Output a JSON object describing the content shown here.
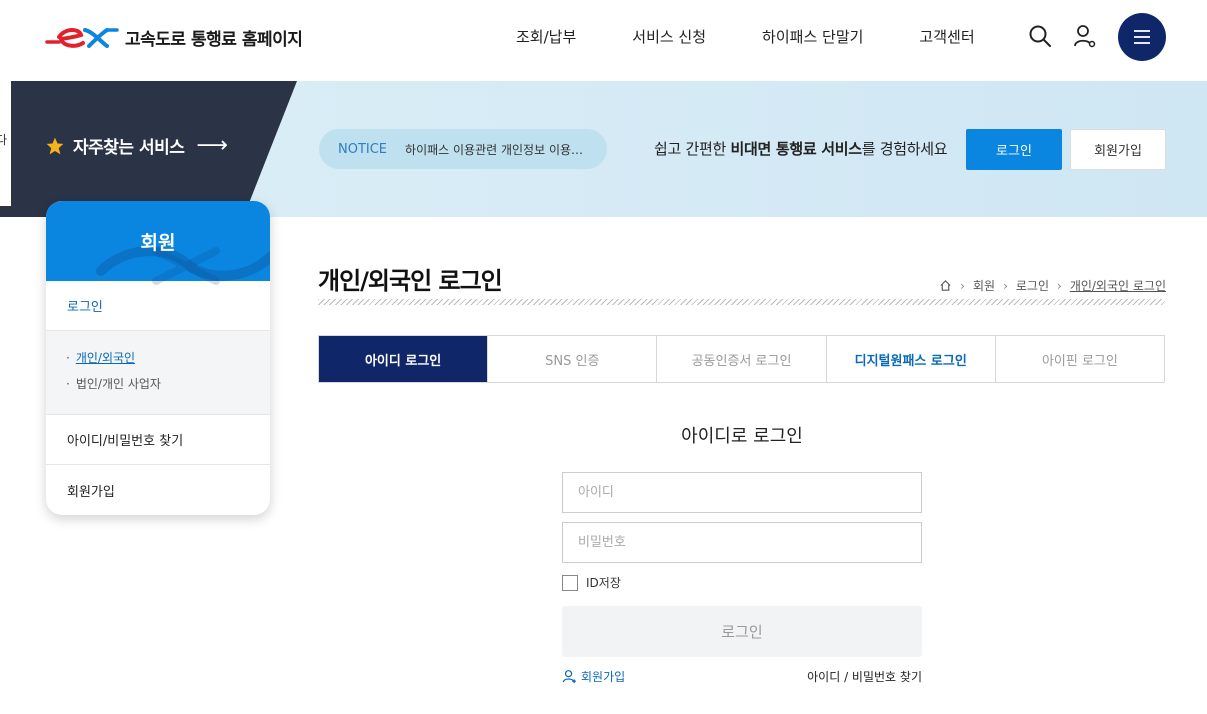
{
  "header": {
    "site_title": "고속도로 통행료 홈페이지",
    "nav": [
      "조회/납부",
      "서비스 신청",
      "하이패스 단말기",
      "고객센터"
    ],
    "icons": [
      "search-icon",
      "user-icon",
      "menu-icon"
    ]
  },
  "band": {
    "left_tab_char": "다",
    "favorite_label": "자주찾는 서비스",
    "notice_label": "NOTICE",
    "notice_text": "하이패스 이용관련 개인정보 이용내역 안내",
    "promo_prefix": "쉽고 간편한 ",
    "promo_bold": "비대면 통행료 서비스",
    "promo_suffix": "를 경험하세요",
    "login_button": "로그인",
    "join_button": "회원가입"
  },
  "side": {
    "title": "회원",
    "items": [
      {
        "label": "로그인"
      },
      {
        "label": "아이디/비밀번호 찾기"
      },
      {
        "label": "회원가입"
      }
    ],
    "sub_items": [
      "개인/외국인",
      "법인/개인 사업자"
    ]
  },
  "main": {
    "title": "개인/외국인 로그인",
    "breadcrumb": [
      "회원",
      "로그인",
      "개인/외국인 로그인"
    ],
    "tabs": [
      "아이디 로그인",
      "SNS 인증",
      "공동인증서 로그인",
      "디지털원패스 로그인",
      "아이핀 로그인"
    ],
    "form_title": "아이디로 로그인",
    "id_placeholder": "아이디",
    "pw_placeholder": "비밀번호",
    "save_id_label": "ID저장",
    "login_button": "로그인",
    "join_link": "회원가입",
    "find_link": "아이디 / 비밀번호 찾기"
  },
  "colors": {
    "navy": "#0f2668",
    "accent_blue": "#0a86e0",
    "logo_red": "#e3202b"
  }
}
